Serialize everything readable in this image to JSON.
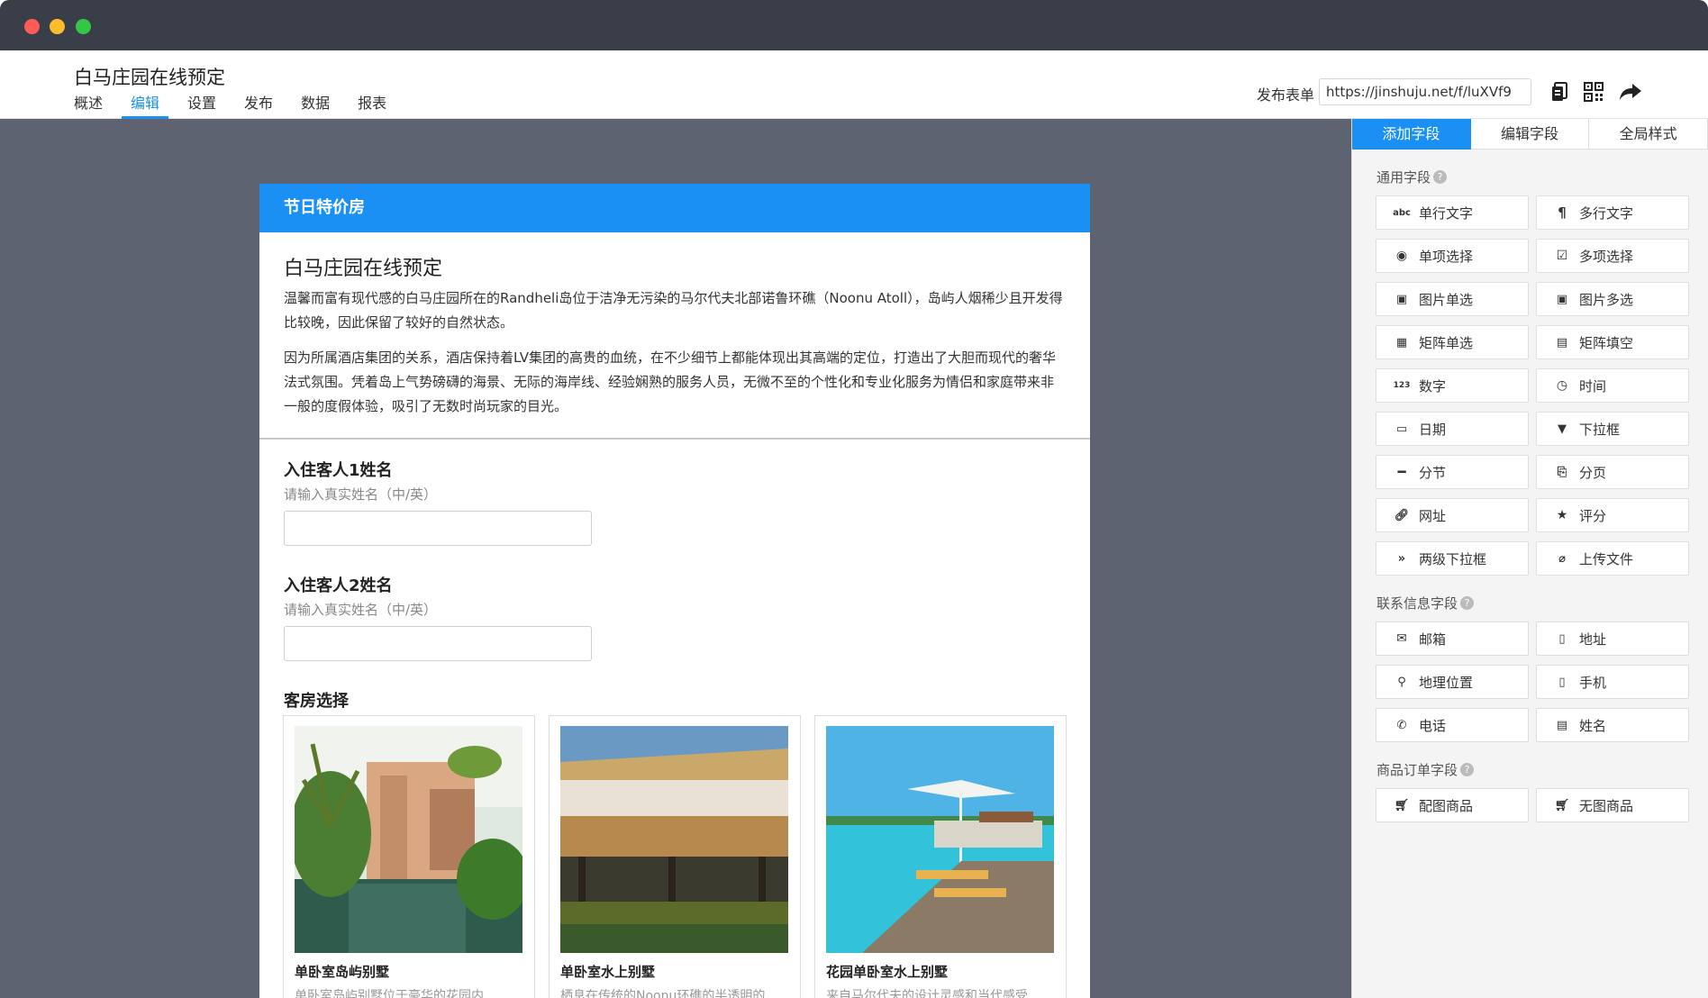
{
  "app": {
    "title": "白马庄园在线预定",
    "nav": [
      "概述",
      "编辑",
      "设置",
      "发布",
      "数据",
      "报表"
    ],
    "publish_label": "发布表单",
    "publish_url": "https://jinshuju.net/f/luXVf9"
  },
  "form": {
    "banner": "节日特价房",
    "title": "白马庄园在线预定",
    "desc1": "温馨而富有现代感的白马庄园所在的Randheli岛位于洁净无污染的马尔代夫北部诺鲁环礁（Noonu Atoll），岛屿人烟稀少且开发得比较晚，因此保留了较好的自然状态。",
    "desc2": "因为所属酒店集团的关系，酒店保持着LV集团的高贵的血统，在不少细节上都能体现出其高端的定位，打造出了大胆而现代的奢华法式氛围。凭着岛上气势磅礴的海景、无际的海岸线、经验娴熟的服务人员，无微不至的个性化和专业化服务为情侣和家庭带来非一般的度假体验，吸引了无数时尚玩家的目光。",
    "fields": [
      {
        "label": "入住客人1姓名",
        "hint": "请输入真实姓名（中/英）"
      },
      {
        "label": "入住客人2姓名",
        "hint": "请输入真实姓名（中/英）"
      }
    ],
    "rooms_label": "客房选择",
    "rooms": [
      {
        "name": "单卧室岛屿别墅",
        "desc": "单卧室岛屿别墅位于豪华的花园内"
      },
      {
        "name": "单卧室水上别墅",
        "desc": "栖息在传统的Noonu环礁的半透明的"
      },
      {
        "name": "花园单卧室水上别墅",
        "desc": "来自马尔代夫的设计灵感和当代感受"
      }
    ]
  },
  "sidebar": {
    "tabs": [
      "添加字段",
      "编辑字段",
      "全局样式"
    ],
    "sections": [
      {
        "label": "通用字段",
        "items": [
          {
            "label": "单行文字",
            "icon": "abc-icon"
          },
          {
            "label": "多行文字",
            "icon": "paragraph-icon"
          },
          {
            "label": "单项选择",
            "icon": "radio-icon"
          },
          {
            "label": "多项选择",
            "icon": "checkbox-icon"
          },
          {
            "label": "图片单选",
            "icon": "image-radio-icon"
          },
          {
            "label": "图片多选",
            "icon": "image-checkbox-icon"
          },
          {
            "label": "矩阵单选",
            "icon": "matrix-icon"
          },
          {
            "label": "矩阵填空",
            "icon": "matrix-fill-icon"
          },
          {
            "label": "数字",
            "icon": "number-icon"
          },
          {
            "label": "时间",
            "icon": "clock-icon"
          },
          {
            "label": "日期",
            "icon": "calendar-icon"
          },
          {
            "label": "下拉框",
            "icon": "dropdown-icon"
          },
          {
            "label": "分节",
            "icon": "section-icon"
          },
          {
            "label": "分页",
            "icon": "page-break-icon"
          },
          {
            "label": "网址",
            "icon": "link-icon"
          },
          {
            "label": "评分",
            "icon": "star-icon"
          },
          {
            "label": "两级下拉框",
            "icon": "double-chevron-icon"
          },
          {
            "label": "上传文件",
            "icon": "paperclip-icon"
          }
        ]
      },
      {
        "label": "联系信息字段",
        "items": [
          {
            "label": "邮箱",
            "icon": "envelope-icon"
          },
          {
            "label": "地址",
            "icon": "building-icon"
          },
          {
            "label": "地理位置",
            "icon": "map-pin-icon"
          },
          {
            "label": "手机",
            "icon": "mobile-icon"
          },
          {
            "label": "电话",
            "icon": "phone-icon"
          },
          {
            "label": "姓名",
            "icon": "id-card-icon"
          }
        ]
      },
      {
        "label": "商品订单字段",
        "items": [
          {
            "label": "配图商品",
            "icon": "cart-icon"
          },
          {
            "label": "无图商品",
            "icon": "cart-plain-icon"
          }
        ]
      }
    ]
  }
}
